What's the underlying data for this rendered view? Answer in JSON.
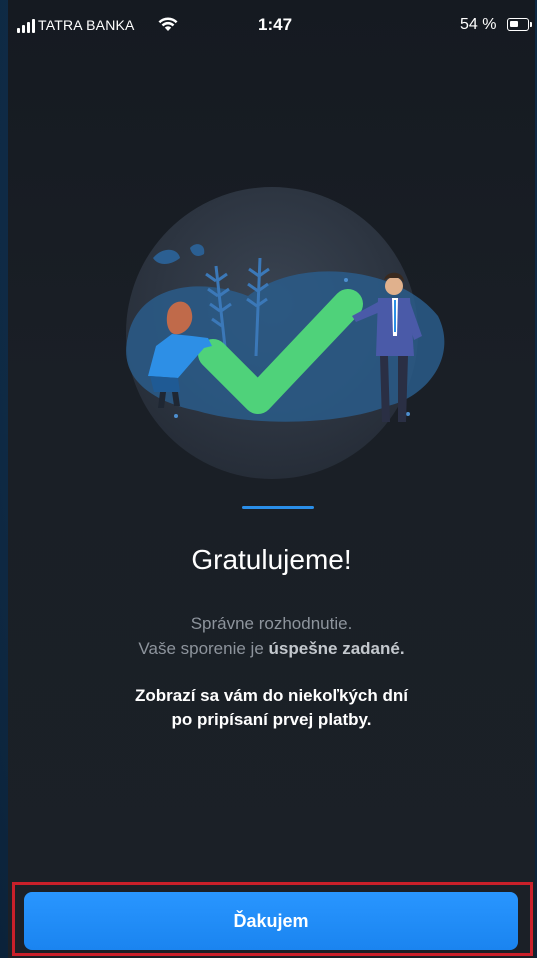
{
  "status_bar": {
    "carrier": "TATRA BANKA",
    "time": "1:47",
    "battery_percent_label": "54 %",
    "battery_level": 0.54,
    "signal_icon": "signal-bars-icon",
    "wifi_icon": "wifi-icon",
    "battery_icon": "battery-icon"
  },
  "illustration": {
    "name": "success-checkmark-illustration"
  },
  "content": {
    "title": "Gratulujeme!",
    "subtitle_line1": "Správne rozhodnutie.",
    "subtitle_line2_prefix": "Vaše sporenie je ",
    "subtitle_line2_bold": "úspešne zadané.",
    "info_line1": "Zobrazí sa vám do niekoľkých dní",
    "info_line2": "po pripísaní prvej platby."
  },
  "actions": {
    "confirm_label": "Ďakujem"
  },
  "colors": {
    "accent": "#2a8ee8",
    "button": "#1f8cf8",
    "highlight_border": "#c9202a",
    "check": "#4fd27a"
  }
}
